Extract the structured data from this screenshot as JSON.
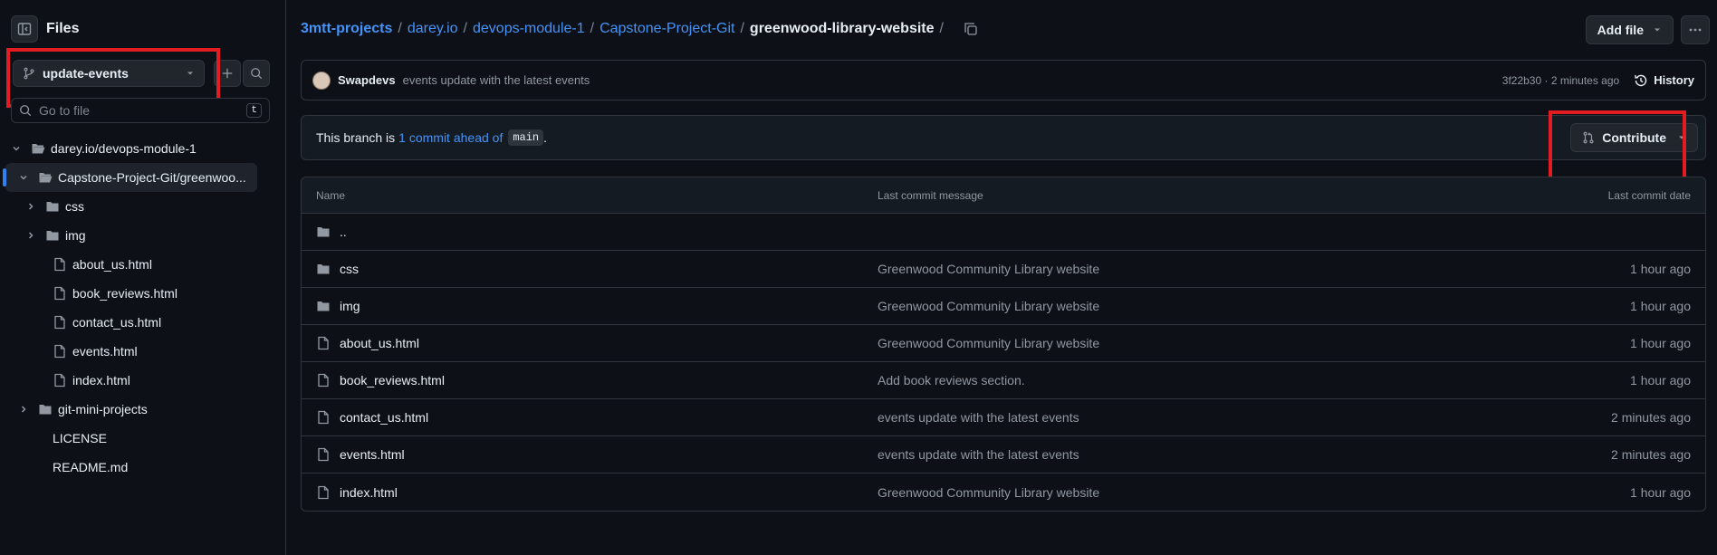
{
  "sidebar": {
    "title": "Files",
    "branch": "update-events",
    "goto_placeholder": "Go to file",
    "goto_shortcut": "t",
    "tree": [
      {
        "label": "darey.io/devops-module-1",
        "type": "folder-open",
        "depth": 0,
        "chevron": "down"
      },
      {
        "label": "Capstone-Project-Git/greenwoo...",
        "type": "folder-open",
        "depth": 1,
        "chevron": "down",
        "active": true
      },
      {
        "label": "css",
        "type": "folder",
        "depth": 2,
        "chevron": "right"
      },
      {
        "label": "img",
        "type": "folder",
        "depth": 2,
        "chevron": "right"
      },
      {
        "label": "about_us.html",
        "type": "file",
        "depth": 2
      },
      {
        "label": "book_reviews.html",
        "type": "file",
        "depth": 2
      },
      {
        "label": "contact_us.html",
        "type": "file",
        "depth": 2
      },
      {
        "label": "events.html",
        "type": "file",
        "depth": 2
      },
      {
        "label": "index.html",
        "type": "file",
        "depth": 2
      },
      {
        "label": "git-mini-projects",
        "type": "folder",
        "depth": 1,
        "chevron": "right"
      },
      {
        "label": "LICENSE",
        "type": "plain",
        "depth": 0
      },
      {
        "label": "README.md",
        "type": "plain",
        "depth": 0
      }
    ]
  },
  "breadcrumb": {
    "items": [
      "3mtt-projects",
      "darey.io",
      "devops-module-1",
      "Capstone-Project-Git"
    ],
    "current": "greenwood-library-website",
    "trailing_sep": "/"
  },
  "header": {
    "add_file_label": "Add file"
  },
  "commit": {
    "author": "Swapdevs",
    "message": "events update with the latest events",
    "meta": "3f22b30 · 2 minutes ago",
    "history_label": "History"
  },
  "branch_status": {
    "prefix": "This branch is",
    "link": "1 commit ahead of",
    "base": "main",
    "suffix": ".",
    "contribute_label": "Contribute"
  },
  "table": {
    "headers": {
      "name": "Name",
      "message": "Last commit message",
      "date": "Last commit date"
    },
    "rows": [
      {
        "type": "folder",
        "name": "..",
        "message": "",
        "date": ""
      },
      {
        "type": "folder",
        "name": "css",
        "message": "Greenwood Community Library website",
        "date": "1 hour ago"
      },
      {
        "type": "folder",
        "name": "img",
        "message": "Greenwood Community Library website",
        "date": "1 hour ago"
      },
      {
        "type": "file",
        "name": "about_us.html",
        "message": "Greenwood Community Library website",
        "date": "1 hour ago"
      },
      {
        "type": "file",
        "name": "book_reviews.html",
        "message": "Add book reviews section.",
        "date": "1 hour ago"
      },
      {
        "type": "file",
        "name": "contact_us.html",
        "message": "events update with the latest events",
        "date": "2 minutes ago"
      },
      {
        "type": "file",
        "name": "events.html",
        "message": "events update with the latest events",
        "date": "2 minutes ago"
      },
      {
        "type": "file",
        "name": "index.html",
        "message": "Greenwood Community Library website",
        "date": "1 hour ago"
      }
    ]
  },
  "colors": {
    "accent": "#4493f8",
    "highlight": "#e11d21",
    "background": "#0d1117"
  }
}
